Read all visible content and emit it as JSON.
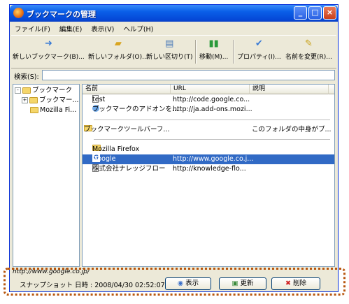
{
  "window": {
    "title": "ブックマークの管理"
  },
  "menu": [
    "ファイル(F)",
    "編集(E)",
    "表示(V)",
    "ヘルプ(H)"
  ],
  "toolbar": [
    {
      "label": "新しいブックマーク(B)...",
      "icon": "new-bookmark-icon"
    },
    {
      "label": "新しいフォルダ(O)...",
      "icon": "new-folder-icon"
    },
    {
      "label": "新しい区切り(T)",
      "icon": "new-separator-icon"
    },
    {
      "label": "移動(M)...",
      "icon": "move-icon"
    },
    {
      "label": "プロパティ(I)...",
      "icon": "properties-icon"
    },
    {
      "label": "名前を変更(R)...",
      "icon": "rename-icon"
    }
  ],
  "search": {
    "label": "検索(S):",
    "value": ""
  },
  "tree": [
    {
      "label": "ブックマーク",
      "expander": "-"
    },
    {
      "label": "ブックマー...",
      "expander": "+"
    },
    {
      "label": "Mozilla Fi...",
      "expander": ""
    }
  ],
  "columns": {
    "name": "名前",
    "url": "URL",
    "desc": "説明"
  },
  "rows": [
    {
      "name": "test",
      "url": "http://code.google.co...",
      "desc": "",
      "icon": "page-icon"
    },
    {
      "name": "ブックマークのアドオンを...",
      "url": "http://ja.add-ons.mozi...",
      "desc": "",
      "icon": "addon-icon"
    },
    {
      "name": "ブックマークツールバーフ...",
      "url": "",
      "desc": "このフォルダの中身がブ...",
      "icon": "folder-icon"
    },
    {
      "name": "Mozilla Firefox",
      "url": "",
      "desc": "",
      "icon": "folder-icon"
    },
    {
      "name": "Google",
      "url": "http://www.google.co.j...",
      "desc": "",
      "icon": "google-icon"
    },
    {
      "name": "株式会社ナレッジフロー",
      "url": "http://knowledge-flo...",
      "desc": "",
      "icon": "page-icon"
    }
  ],
  "status": {
    "url": "http://www.google.co.jp/"
  },
  "snapshot": {
    "text": "スナップショット 日時 : 2008/04/30 02:52:07",
    "view_label": "表示",
    "update_label": "更新",
    "delete_label": "削除"
  },
  "colors": {
    "accent": "#316ac5",
    "highlight_frame": "#b8560e",
    "titlebar": "#0a5fe8"
  }
}
